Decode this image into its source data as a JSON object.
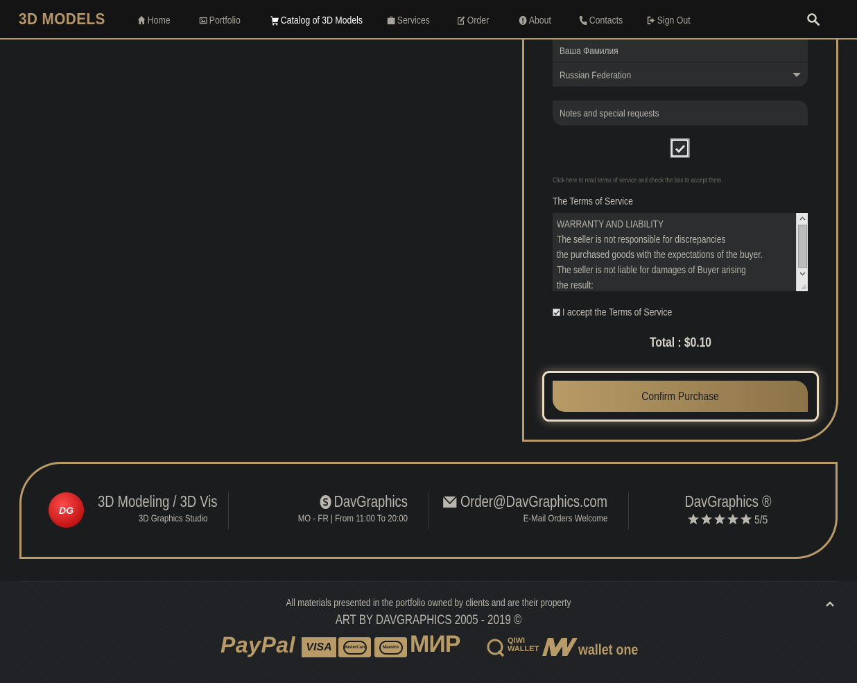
{
  "nav": {
    "brand": "3D MODELS",
    "items": [
      {
        "label": "Home",
        "icon": "home-icon"
      },
      {
        "label": "Portfolio",
        "icon": "image-icon"
      },
      {
        "label": "Catalog of 3D Models",
        "icon": "cart-icon",
        "active": true
      },
      {
        "label": "Services",
        "icon": "briefcase-icon"
      },
      {
        "label": "Order",
        "icon": "edit-icon"
      },
      {
        "label": "About",
        "icon": "info-icon"
      },
      {
        "label": "Contacts",
        "icon": "phone-icon"
      },
      {
        "label": "Sign Out",
        "icon": "sign-out-icon"
      }
    ]
  },
  "form": {
    "lastname_placeholder": "Ваша Фамилия",
    "country_value": "Russian Federation",
    "notes_placeholder": "Notes and special requests",
    "terms_hint": "Click here to read terms of service and check the box to accept them.",
    "terms_title": "The Terms of Service",
    "terms_lines": [
      "WARRANTY AND LIABILITY",
      "The seller is not responsible for discrepancies",
      "the purchased goods with the expectations of the buyer.",
      "The seller is not liable for damages of Buyer arising",
      "the result:"
    ],
    "accept_label": "I accept the Terms of Service",
    "total": "Total : $0.10",
    "confirm_label": "Confirm Purchase"
  },
  "footer": {
    "col1_title": "3D Modeling / 3D Vis",
    "col1_sub": "3D Graphics Studio",
    "logo_text": "DG",
    "col2_title": "DavGraphics",
    "col2_sub": "MO - FR | From 11:00 To 20:00",
    "col3_title": "Order@DavGraphics.com",
    "col3_sub": "E-Mail Orders Welcome",
    "col4_title": "DavGraphics ®",
    "rating": "5/5",
    "rating_value": 5,
    "copyright_line1": "All materials presented in the portfolio owned by clients and are their property",
    "copyright_line2": "ART BY DAVGRAPHICS 2005 - 2019 ©",
    "payments": {
      "paypal": "PayPal",
      "visa": "VISA",
      "mastercard": "MasterCard",
      "maestro": "Maestro",
      "mir": "МИР",
      "qiwi_line1": "QIWI",
      "qiwi_line2": "WALLET",
      "walletone": "wallet one"
    }
  },
  "colors": {
    "accent": "#b89b66",
    "background": "#1b1c1e",
    "field": "#2c2d2f"
  }
}
